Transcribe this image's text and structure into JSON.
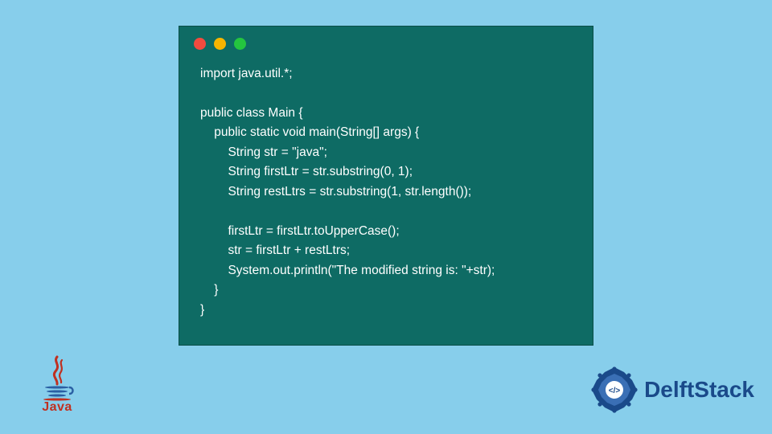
{
  "code_window": {
    "dots": [
      "red",
      "yellow",
      "green"
    ],
    "code": "import java.util.*;\n\npublic class Main {\n    public static void main(String[] args) {\n        String str = \"java\";\n        String firstLtr = str.substring(0, 1);\n        String restLtrs = str.substring(1, str.length());\n\n        firstLtr = firstLtr.toUpperCase();\n        str = firstLtr + restLtrs;\n        System.out.println(\"The modified string is: \"+str);\n    }\n}"
  },
  "logos": {
    "java_label": "Java",
    "delft_label": "DelftStack"
  }
}
